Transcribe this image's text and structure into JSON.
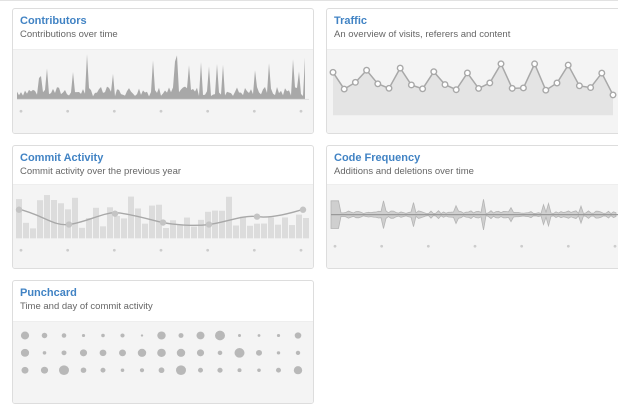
{
  "cards": {
    "contributors": {
      "title": "Contributors",
      "subtitle": "Contributions over time"
    },
    "traffic": {
      "title": "Traffic",
      "subtitle": "An overview of visits, referers and content"
    },
    "commit_activity": {
      "title": "Commit Activity",
      "subtitle": "Commit activity over the previous year"
    },
    "code_frequency": {
      "title": "Code Frequency",
      "subtitle": "Additions and deletions over time"
    },
    "punchcard": {
      "title": "Punchcard",
      "subtitle": "Time and day of commit activity"
    }
  },
  "colors": {
    "link": "#4183c4",
    "muted": "#666666",
    "graph": "#aaaaaa",
    "thumb_bg": "#f4f4f4"
  }
}
